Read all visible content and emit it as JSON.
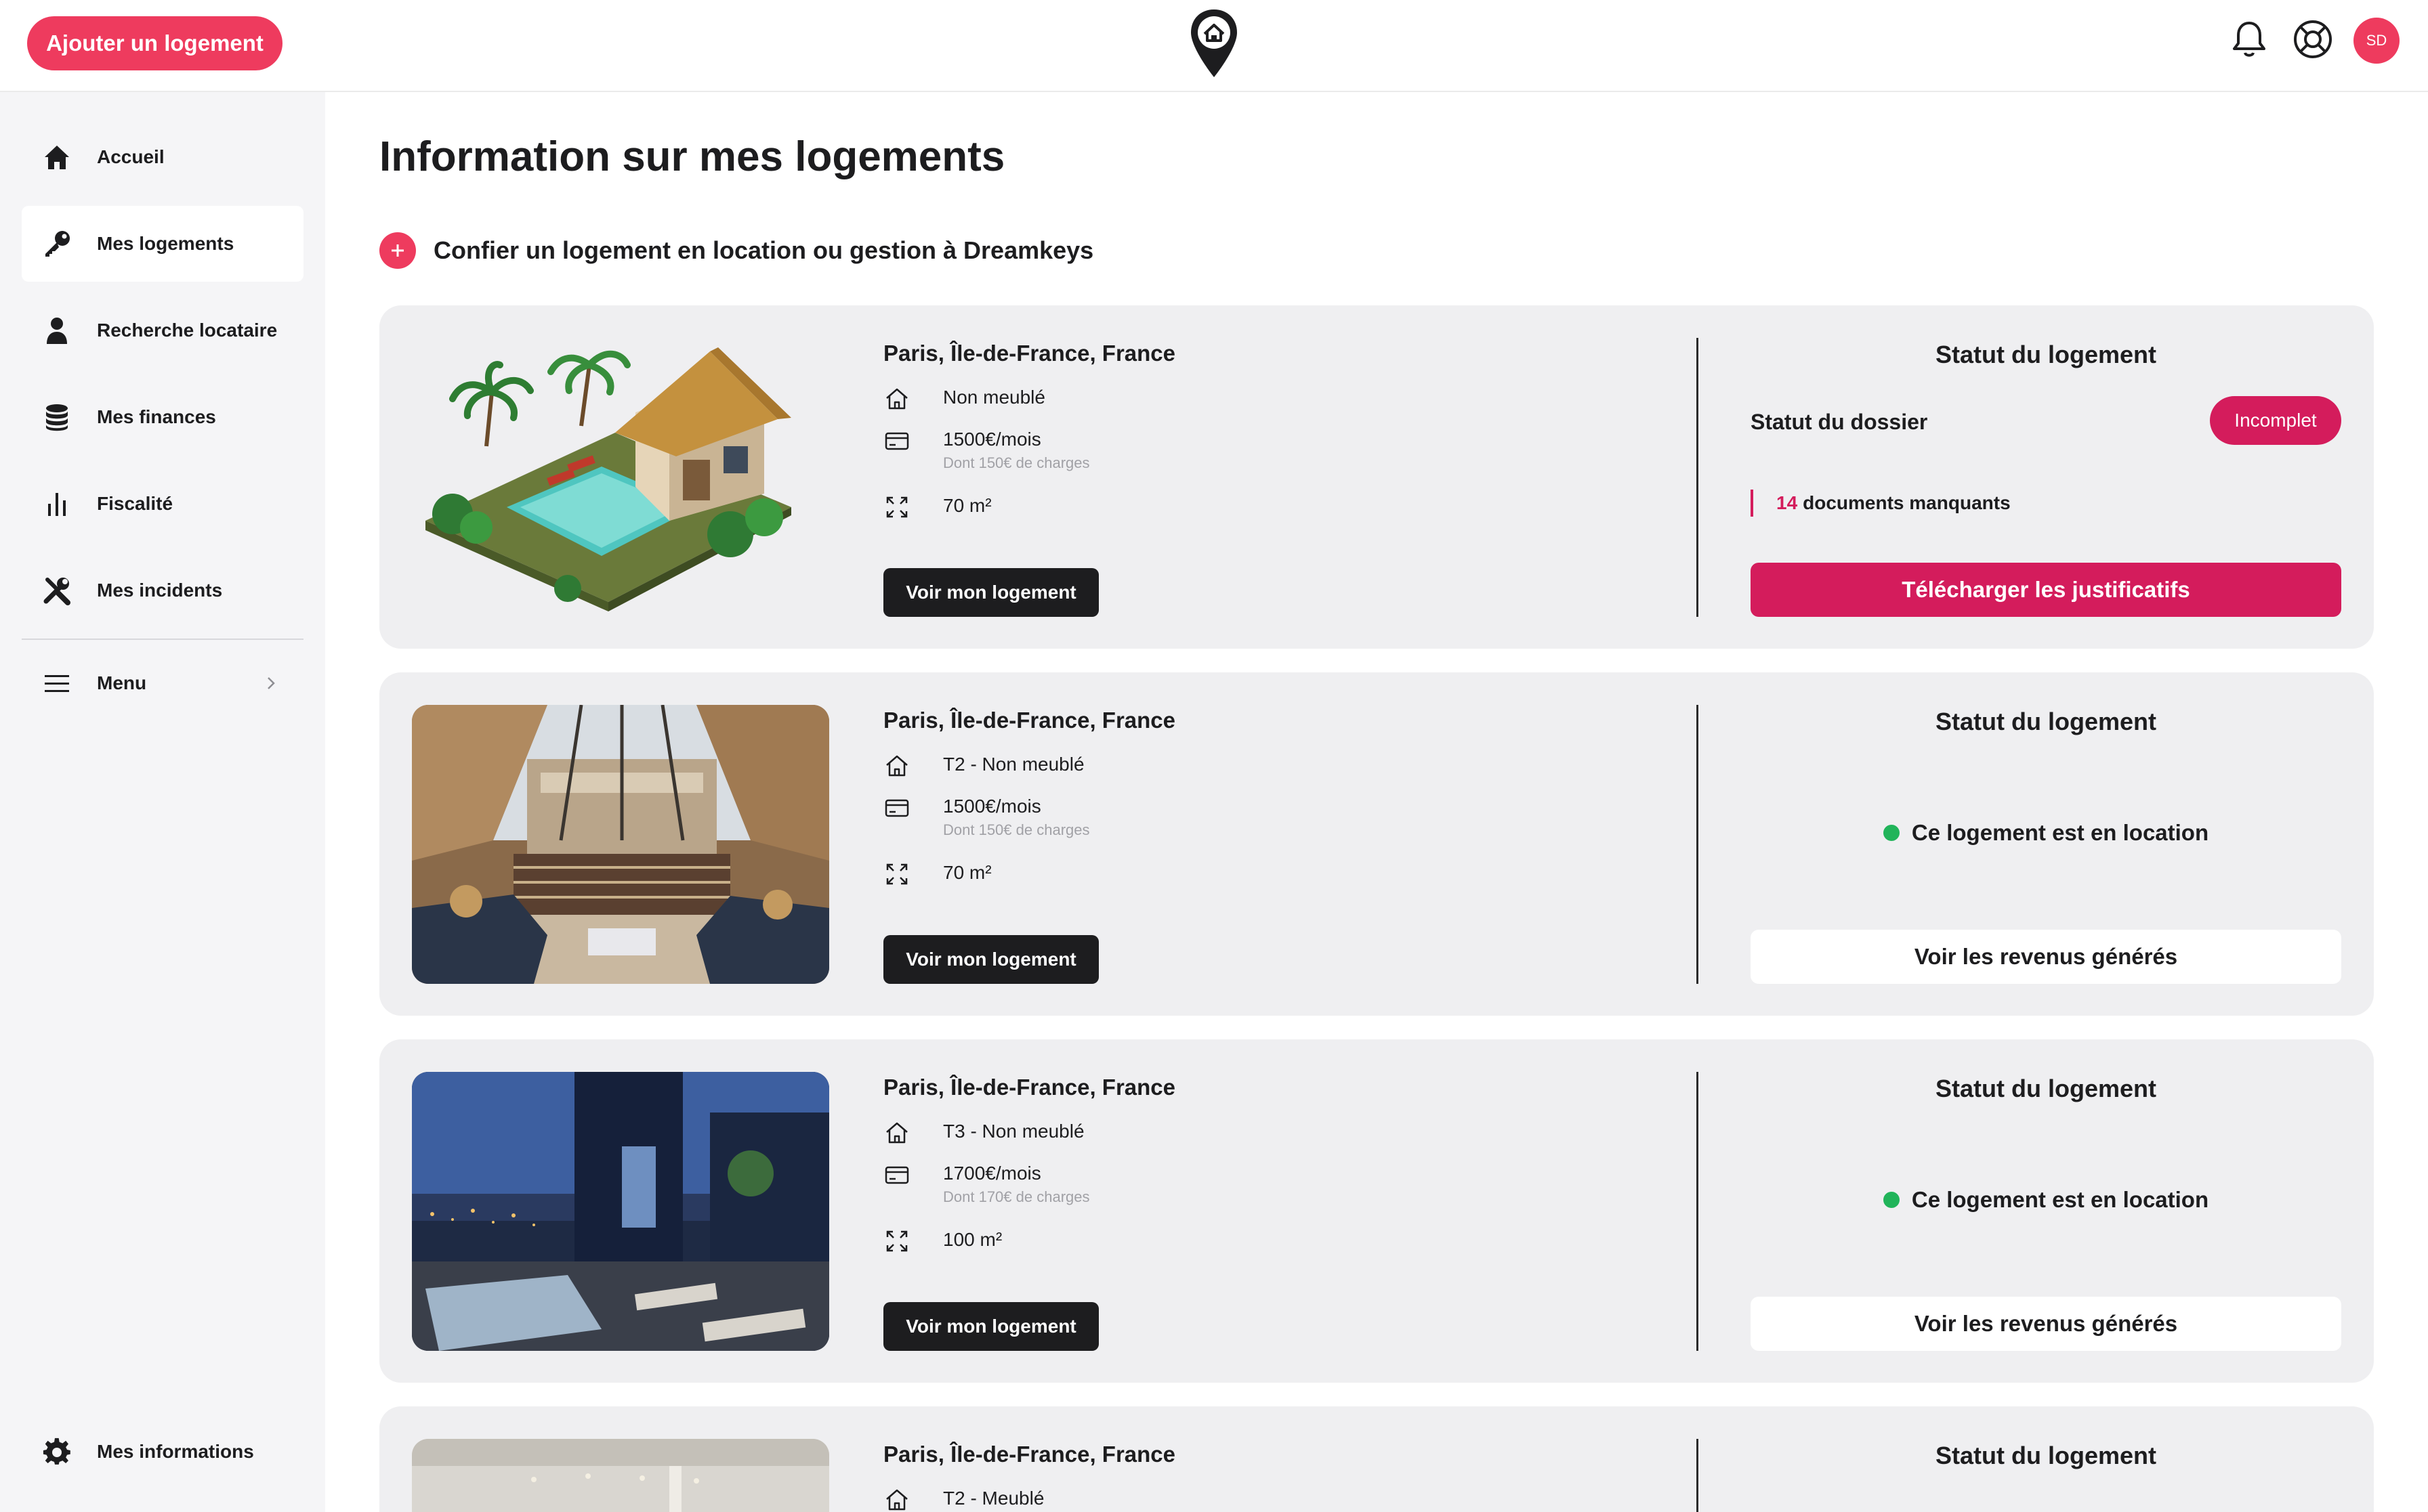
{
  "topbar": {
    "add_button": "Ajouter un logement",
    "logo_icon": "home-pin-icon",
    "notification_icon": "bell-icon",
    "help_icon": "lifebuoy-icon",
    "avatar_initials": "SD"
  },
  "colors": {
    "brand": "#ee3b5e",
    "accent_dark": "#d41c5c",
    "status_green": "#21b45a",
    "card_bg": "#efeff1",
    "sidebar_bg": "#f5f5f7"
  },
  "sidebar": {
    "items": [
      {
        "label": "Accueil",
        "icon": "home-icon"
      },
      {
        "label": "Mes logements",
        "icon": "key-icon",
        "active": true
      },
      {
        "label": "Recherche locataire",
        "icon": "person-icon"
      },
      {
        "label": "Mes finances",
        "icon": "coins-icon"
      },
      {
        "label": "Fiscalité",
        "icon": "bar-chart-icon"
      },
      {
        "label": "Mes incidents",
        "icon": "tools-icon"
      }
    ],
    "menu": {
      "label": "Menu",
      "icon": "hamburger-icon"
    },
    "bottom": {
      "label": "Mes informations",
      "icon": "gear-icon"
    }
  },
  "main": {
    "title": "Information sur mes logements",
    "confier": "Confier un logement en location ou gestion à Dreamkeys",
    "see_button": "Voir mon logement",
    "status_title": "Statut du logement",
    "properties": [
      {
        "location": "Paris, Île-de-France, France",
        "type": "Non meublé",
        "price": "1500€/mois",
        "charges": "Dont 150€ de charges",
        "surface": "70 m²",
        "status": {
          "dossier_label": "Statut du dossier",
          "badge": "Incomplet",
          "missing_count": "14",
          "missing_text": "documents manquants",
          "action": "Télécharger les justificatifs"
        }
      },
      {
        "location": "Paris, Île-de-France, France",
        "type": "T2 - Non meublé",
        "price": "1500€/mois",
        "charges": "Dont 150€ de charges",
        "surface": "70 m²",
        "status": {
          "text": "Ce logement est en location",
          "action": "Voir les revenus générés"
        }
      },
      {
        "location": "Paris, Île-de-France, France",
        "type": "T3 - Non meublé",
        "price": "1700€/mois",
        "charges": "Dont 170€ de charges",
        "surface": "100 m²",
        "status": {
          "text": "Ce logement est en location",
          "action": "Voir les revenus générés"
        }
      },
      {
        "location": "Paris, Île-de-France, France",
        "type": "T2 - Meublé"
      }
    ]
  }
}
